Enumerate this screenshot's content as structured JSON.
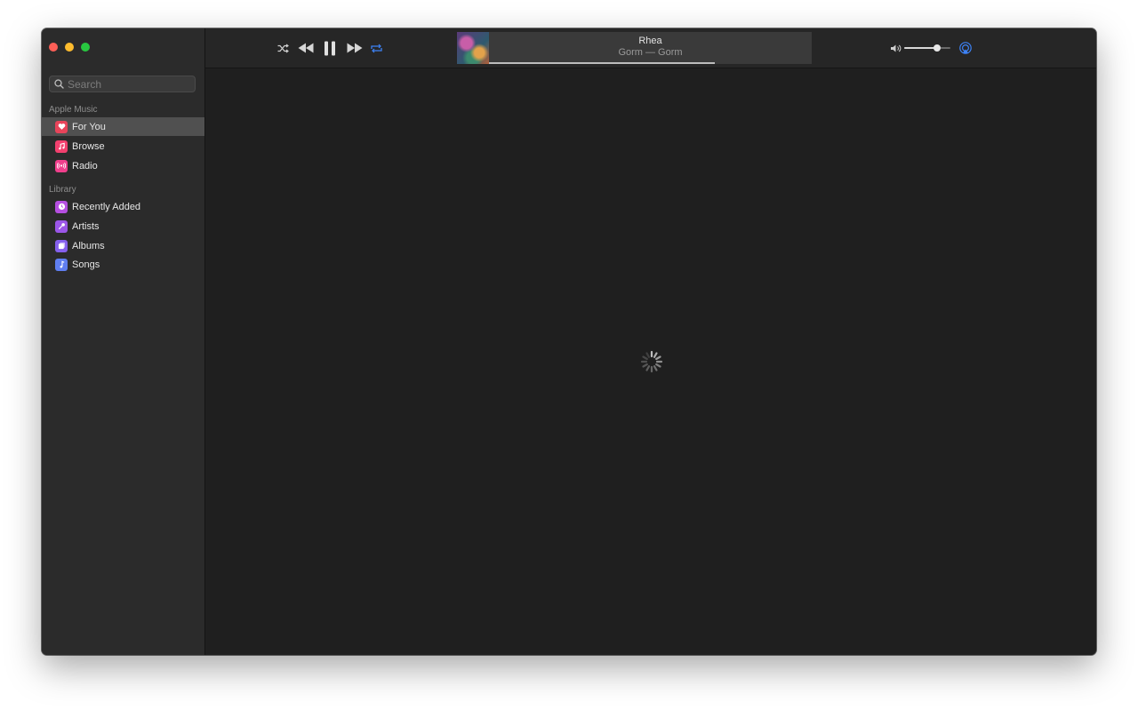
{
  "sidebar": {
    "search_placeholder": "Search",
    "sections": [
      {
        "label": "Apple Music",
        "items": [
          {
            "label": "For You",
            "icon": "heart-icon",
            "color": "#e8445a",
            "selected": true
          },
          {
            "label": "Browse",
            "icon": "music-note-icon",
            "color": "#f2406e"
          },
          {
            "label": "Radio",
            "icon": "radio-waves-icon",
            "color": "#f03f8c"
          }
        ]
      },
      {
        "label": "Library",
        "items": [
          {
            "label": "Recently Added",
            "icon": "clock-icon",
            "color": "#b54fe0"
          },
          {
            "label": "Artists",
            "icon": "microphone-icon",
            "color": "#9b56e8"
          },
          {
            "label": "Albums",
            "icon": "album-icon",
            "color": "#8560ec"
          },
          {
            "label": "Songs",
            "icon": "music-note-icon",
            "color": "#5f7ef0"
          }
        ]
      }
    ]
  },
  "player": {
    "title": "Rhea",
    "subtitle": "Gorm — Gorm",
    "progress": 0.7,
    "volume": 0.72,
    "repeat_color": "#3d82f6",
    "airplay_color": "#3d82f6"
  },
  "colors": {
    "window_bg": "#1f1f1f",
    "sidebar_bg": "#2b2b2b",
    "selected_bg": "#505050"
  }
}
